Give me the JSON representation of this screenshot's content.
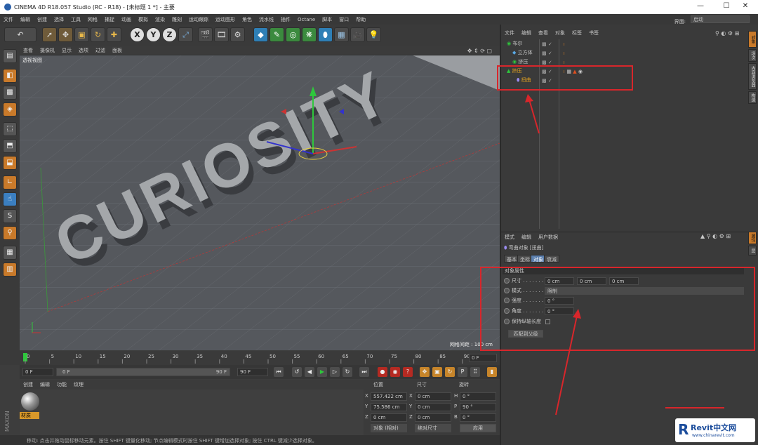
{
  "titlebar": {
    "title": "CINEMA 4D R18.057 Studio (RC - R18) - [未标题 1 *] - 主要",
    "minimize": "—",
    "maximize": "☐",
    "close": "✕"
  },
  "menubar": {
    "items": [
      "文件",
      "编辑",
      "创建",
      "选择",
      "工具",
      "网格",
      "捕捉",
      "动画",
      "模拟",
      "渲染",
      "雕刻",
      "运动跟踪",
      "运动图形",
      "角色",
      "流水线",
      "插件",
      "Octane",
      "脚本",
      "窗口",
      "帮助"
    ],
    "layout_label": "界面:",
    "layout_value": "启动"
  },
  "toolbar": {
    "undo_icon": "undo-icon",
    "x": "X",
    "y": "Y",
    "z": "Z"
  },
  "viewport": {
    "menu": [
      "查看",
      "摄像机",
      "显示",
      "选项",
      "过滤",
      "面板"
    ],
    "label": "透视视图",
    "text": "CURIOSITY",
    "grid_info": "网格间距 : 100 cm"
  },
  "timeline": {
    "ticks": [
      "0",
      "5",
      "10",
      "15",
      "20",
      "25",
      "30",
      "35",
      "40",
      "45",
      "50",
      "55",
      "60",
      "65",
      "70",
      "75",
      "80",
      "85",
      "90"
    ],
    "current": "0 F"
  },
  "playbar": {
    "start": "0 F",
    "min": "0 F",
    "max": "90 F",
    "end": "90 F"
  },
  "material": {
    "menu": [
      "创建",
      "编辑",
      "功能",
      "纹理"
    ],
    "mat_name": "材质"
  },
  "coords": {
    "headers": [
      "位置",
      "尺寸",
      "旋转"
    ],
    "rows": [
      {
        "a": "X",
        "pos": "557.422 cm",
        "b": "X",
        "size": "0 cm",
        "c": "H",
        "rot": "0 °"
      },
      {
        "a": "Y",
        "pos": "75.586 cm",
        "b": "Y",
        "size": "0 cm",
        "c": "P",
        "rot": "90 °"
      },
      {
        "a": "Z",
        "pos": "0 cm",
        "b": "Z",
        "size": "0 cm",
        "c": "B",
        "rot": "0 °"
      }
    ],
    "mode": "对象 (相对)",
    "size_mode": "绝对尺寸",
    "apply": "应用"
  },
  "status": "移动: 点击并拖动鼠标移动元素。按住 SHIFT 键量化移动; 节点编辑模式时按住 SHIFT 键增加选择对象; 按住 CTRL 键减少选择对象。",
  "objects": {
    "menu": [
      "文件",
      "编辑",
      "查看",
      "对象",
      "标签",
      "书签"
    ],
    "items": [
      {
        "name": "布尔",
        "color": "#c8c8c8"
      },
      {
        "name": "立方体",
        "color": "#c8c8c8"
      },
      {
        "name": "挤压",
        "color": "#c8c8c8"
      },
      {
        "name": "挤压",
        "color": "#e0a020"
      },
      {
        "name": "扭曲",
        "color": "#e0a020"
      }
    ]
  },
  "attributes": {
    "menu": [
      "模式",
      "编辑",
      "用户数据"
    ],
    "title": "弯曲对象 [扭曲]",
    "tabs": [
      "基本",
      "坐标",
      "对象",
      "衰减"
    ],
    "section": "对象属性",
    "size_label": "尺寸 . . . . . . .",
    "size": [
      "0 cm",
      "0 cm",
      "0 cm"
    ],
    "mode_label": "模式 . . . . . . .",
    "mode": "限制",
    "strength_label": "强度 . . . . . . .",
    "strength": "0 °",
    "angle_label": "角度 . . . . . . .",
    "angle": "0 °",
    "keep_label": "保持纵轴长度",
    "fit_button": "匹配到父级"
  },
  "side_tabs": [
    "对象",
    "场次",
    "内容浏览器",
    "构造"
  ],
  "side_tabs2": [
    "属性",
    "层"
  ],
  "watermark": {
    "brand": "Revit中文网",
    "url": "www.chinarevit.com"
  }
}
